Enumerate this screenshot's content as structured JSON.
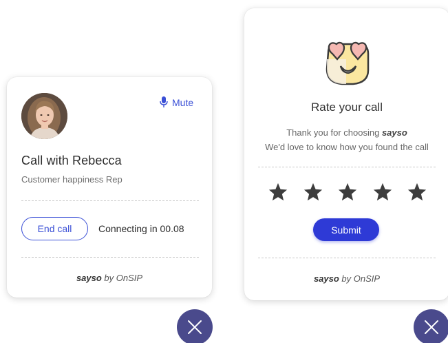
{
  "call_widget": {
    "mute_label": "Mute",
    "title": "Call with Rebecca",
    "subtitle": "Customer happiness Rep",
    "end_call_label": "End call",
    "status": "Connecting in 00.08",
    "brand": "sayso",
    "brand_suffix": " by OnSIP"
  },
  "rate_widget": {
    "title": "Rate your call",
    "thanks_line1": "Thank you for choosing ",
    "thanks_brand": "sayso",
    "thanks_line2": "We'd love to know how you found the call",
    "stars": [
      "star-1",
      "star-2",
      "star-3",
      "star-4",
      "star-5"
    ],
    "submit_label": "Submit",
    "brand": "sayso",
    "brand_suffix": " by OnSIP"
  },
  "colors": {
    "accent": "#3a4fd6",
    "submit_bg": "#2e3ad6",
    "close_bg": "#4a4a8c",
    "star": "#3d3d3d"
  },
  "icons": [
    "microphone-icon",
    "heart-eyes-emoji-icon",
    "star-icon",
    "close-icon"
  ]
}
